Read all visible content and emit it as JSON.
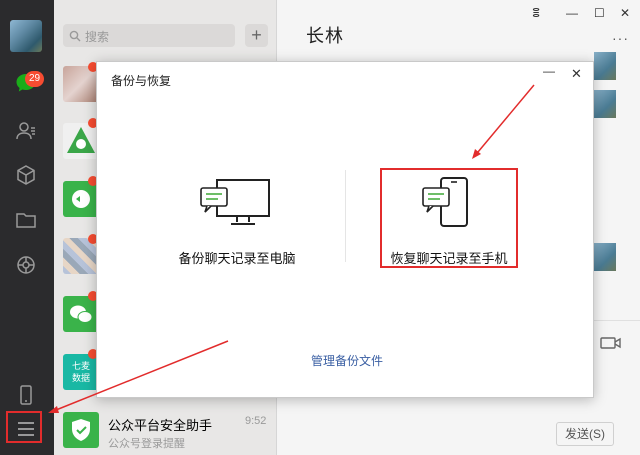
{
  "sidebar": {
    "unread_count": "29",
    "icons": [
      "chat-icon",
      "contacts-icon",
      "cube-icon",
      "folder-icon",
      "moments-icon",
      "phone-icon",
      "menu-icon"
    ]
  },
  "search": {
    "placeholder": "搜索"
  },
  "chats": {
    "last_item": {
      "name": "公众平台安全助手",
      "subtitle": "公众号登录提醒",
      "time": "9:52"
    },
    "tile_label_line1": "七麦",
    "tile_label_line2": "数据"
  },
  "chat_area": {
    "title": "长林",
    "send_label": "发送(S)",
    "controls": {
      "pin": "ⴻ",
      "minimize": "—",
      "maximize": "☐",
      "close": "✕"
    }
  },
  "modal": {
    "title": "备份与恢复",
    "min_label": "—",
    "close_label": "✕",
    "backup_option": "备份聊天记录至电脑",
    "restore_option": "恢复聊天记录至手机",
    "manage_link": "管理备份文件"
  },
  "colors": {
    "sidebar_bg": "#2b2b2d",
    "highlight_red": "#e22c2c",
    "wechat_green": "#1aad19",
    "icon_green": "#5ab553",
    "link_blue": "#3a5fa3"
  }
}
